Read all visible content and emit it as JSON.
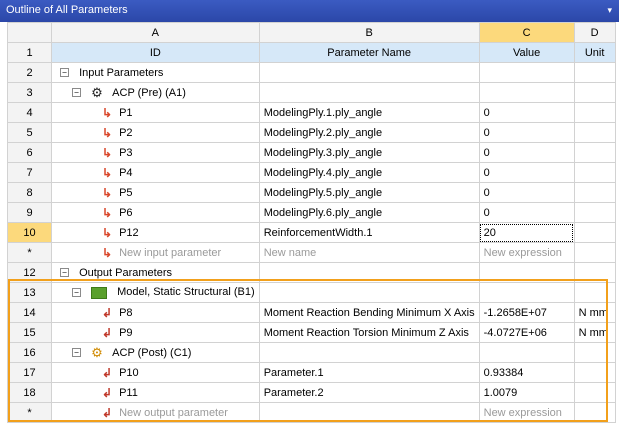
{
  "window": {
    "title": "Outline of All Parameters",
    "dropdown_glyph": "▾"
  },
  "columns": {
    "corner": "",
    "a": "A",
    "b": "B",
    "c": "C",
    "d": "D"
  },
  "headers": {
    "row_num": "1",
    "id": "ID",
    "name": "Parameter Name",
    "value": "Value",
    "unit": "Unit"
  },
  "rows": [
    {
      "num": "2",
      "id": "Input Parameters",
      "name": "",
      "value": "",
      "unit": ""
    },
    {
      "num": "3",
      "id": "ACP (Pre) (A1)",
      "name": "",
      "value": "",
      "unit": ""
    },
    {
      "num": "4",
      "id": "P1",
      "name": "ModelingPly.1.ply_angle",
      "value": "0",
      "unit": ""
    },
    {
      "num": "5",
      "id": "P2",
      "name": "ModelingPly.2.ply_angle",
      "value": "0",
      "unit": ""
    },
    {
      "num": "6",
      "id": "P3",
      "name": "ModelingPly.3.ply_angle",
      "value": "0",
      "unit": ""
    },
    {
      "num": "7",
      "id": "P4",
      "name": "ModelingPly.4.ply_angle",
      "value": "0",
      "unit": ""
    },
    {
      "num": "8",
      "id": "P5",
      "name": "ModelingPly.5.ply_angle",
      "value": "0",
      "unit": ""
    },
    {
      "num": "9",
      "id": "P6",
      "name": "ModelingPly.6.ply_angle",
      "value": "0",
      "unit": ""
    },
    {
      "num": "10",
      "id": "P12",
      "name": "ReinforcementWidth.1",
      "value": "20",
      "unit": ""
    },
    {
      "num": "*",
      "id": "New input parameter",
      "name": "New name",
      "value": "New expression",
      "unit": ""
    },
    {
      "num": "12",
      "id": "Output Parameters",
      "name": "",
      "value": "",
      "unit": ""
    },
    {
      "num": "13",
      "id": "Model, Static Structural (B1)",
      "name": "",
      "value": "",
      "unit": ""
    },
    {
      "num": "14",
      "id": "P8",
      "name": "Moment Reaction Bending Minimum X Axis",
      "value": "-1.2658E+07",
      "unit": "N mm"
    },
    {
      "num": "15",
      "id": "P9",
      "name": "Moment Reaction Torsion Minimum Z Axis",
      "value": "-4.0727E+06",
      "unit": "N mm"
    },
    {
      "num": "16",
      "id": "ACP (Post) (C1)",
      "name": "",
      "value": "",
      "unit": ""
    },
    {
      "num": "17",
      "id": "P10",
      "name": "Parameter.1",
      "value": "0.93384",
      "unit": ""
    },
    {
      "num": "18",
      "id": "P11",
      "name": "Parameter.2",
      "value": "1.0079",
      "unit": ""
    },
    {
      "num": "*",
      "id": "New output parameter",
      "name": "",
      "value": "New expression",
      "unit": ""
    }
  ],
  "icons": {
    "toggle": "⊟",
    "gear": "⚙",
    "param_in": "↳",
    "param_out": "↲"
  },
  "colors": {
    "title_bar": "#2b47a8",
    "highlight": "#f2a01b",
    "selected_col": "#fcd97c",
    "header_row": "#d6e8f8"
  }
}
